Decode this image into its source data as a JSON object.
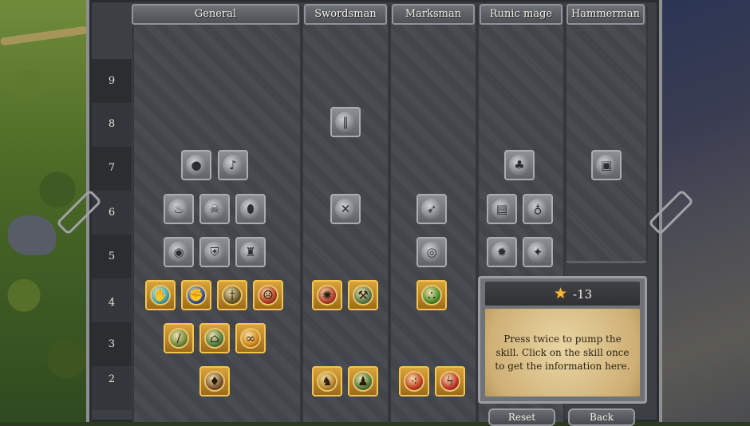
{
  "columns": [
    {
      "label": "General"
    },
    {
      "label": "Swordsman"
    },
    {
      "label": "Marksman"
    },
    {
      "label": "Runic mage"
    },
    {
      "label": "Hammerman"
    }
  ],
  "row_labels": [
    "9",
    "8",
    "7",
    "6",
    "5",
    "4",
    "3",
    "2"
  ],
  "info_panel": {
    "cost": "-13",
    "star_icon": "star-icon",
    "message": "Press twice to pump the skill. Click on the skill once to get the information here."
  },
  "bottom_buttons": {
    "reset": "Reset",
    "back": "Back"
  },
  "skills": [
    {
      "id": "general-7a",
      "icon": "bomb-icon",
      "state": "locked"
    },
    {
      "id": "general-7b",
      "icon": "horn-icon",
      "state": "locked"
    },
    {
      "id": "general-6a",
      "icon": "fire-icon",
      "state": "locked"
    },
    {
      "id": "general-6b",
      "icon": "skull-icon",
      "state": "locked"
    },
    {
      "id": "general-6c",
      "icon": "boot-icon",
      "state": "locked"
    },
    {
      "id": "general-5a",
      "icon": "eye-icon",
      "state": "locked"
    },
    {
      "id": "general-5b",
      "icon": "shield-icon",
      "state": "locked"
    },
    {
      "id": "general-5c",
      "icon": "castle-icon",
      "state": "locked"
    },
    {
      "id": "general-4a",
      "icon": "hand-icon",
      "state": "unlocked"
    },
    {
      "id": "general-4b",
      "icon": "fist-icon",
      "state": "unlocked"
    },
    {
      "id": "general-4c",
      "icon": "sword-icon",
      "state": "unlocked"
    },
    {
      "id": "general-4d",
      "icon": "rage-face-icon",
      "state": "unlocked"
    },
    {
      "id": "general-3a",
      "icon": "blade-icon",
      "state": "unlocked"
    },
    {
      "id": "general-3b",
      "icon": "helmet-icon",
      "state": "unlocked"
    },
    {
      "id": "general-3c",
      "icon": "chain-icon",
      "state": "unlocked"
    },
    {
      "id": "general-2a",
      "icon": "armor-icon",
      "state": "unlocked"
    },
    {
      "id": "swordsman-8a",
      "icon": "blades-icon",
      "state": "locked"
    },
    {
      "id": "swordsman-6a",
      "icon": "cross-swords-icon",
      "state": "locked"
    },
    {
      "id": "swordsman-4a",
      "icon": "aura-icon",
      "state": "unlocked"
    },
    {
      "id": "swordsman-4b",
      "icon": "hammer-icon",
      "state": "unlocked"
    },
    {
      "id": "swordsman-2a",
      "icon": "warrior-icon",
      "state": "unlocked"
    },
    {
      "id": "swordsman-2b",
      "icon": "bear-icon",
      "state": "unlocked"
    },
    {
      "id": "marksman-6a",
      "icon": "arrow-icon",
      "state": "locked"
    },
    {
      "id": "marksman-5a",
      "icon": "target-icon",
      "state": "locked"
    },
    {
      "id": "marksman-4a",
      "icon": "orbs-icon",
      "state": "unlocked"
    },
    {
      "id": "marksman-2a",
      "icon": "bullets-icon",
      "state": "unlocked"
    },
    {
      "id": "marksman-2b",
      "icon": "bolt-icon",
      "state": "unlocked"
    },
    {
      "id": "runic-7a",
      "icon": "rune-icon",
      "state": "locked"
    },
    {
      "id": "runic-6a",
      "icon": "spellbook-icon",
      "state": "locked"
    },
    {
      "id": "runic-6b",
      "icon": "potion-icon",
      "state": "locked"
    },
    {
      "id": "runic-5a",
      "icon": "burst-icon",
      "state": "locked"
    },
    {
      "id": "runic-5b",
      "icon": "vortex-icon",
      "state": "locked"
    },
    {
      "id": "hammerman-7a",
      "icon": "fist-armor-icon",
      "state": "locked"
    }
  ]
}
